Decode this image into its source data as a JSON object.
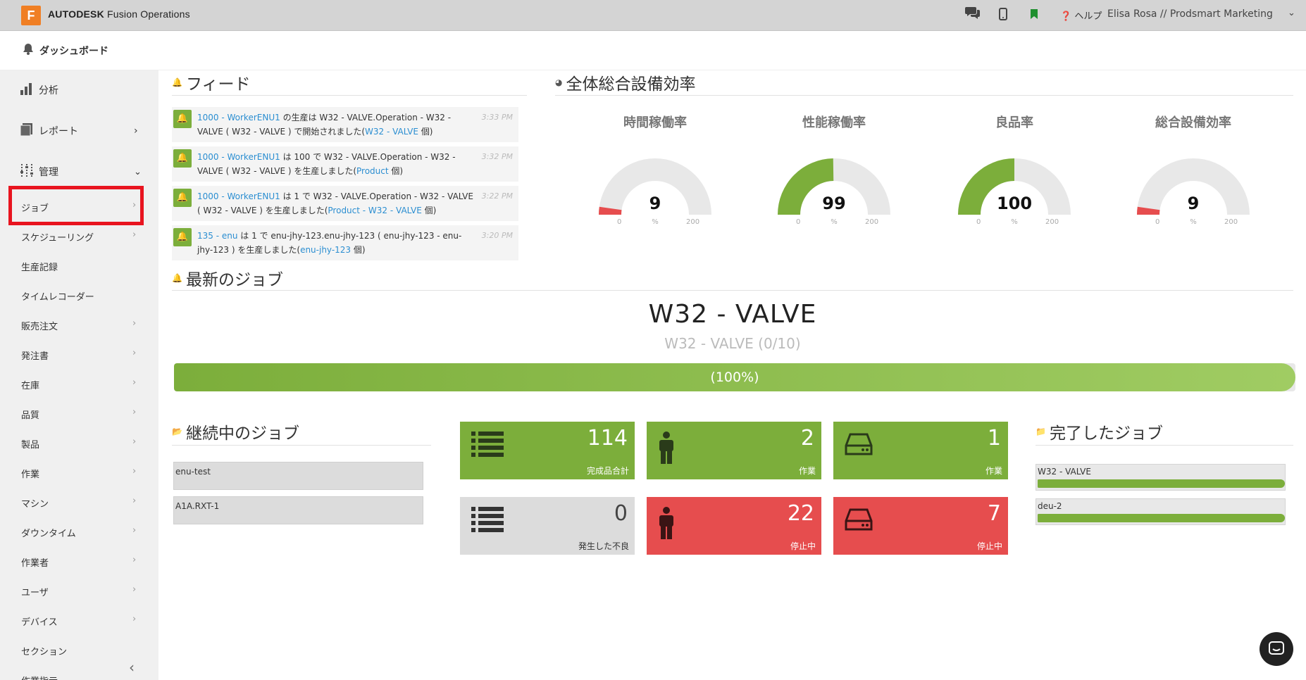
{
  "app": {
    "logo_letter": "F",
    "brand_bold": "AUTODESK",
    "brand_rest": " Fusion Operations",
    "accent": "#f07f24"
  },
  "topbar": {
    "help_label": "ヘルプ",
    "user_label": "Elisa Rosa // Prodsmart Marketing",
    "icons": [
      "chat-icon",
      "mobile-icon",
      "bookmark-icon",
      "help-icon"
    ]
  },
  "header": {
    "title": "ダッシュボード"
  },
  "sidebar": {
    "big_items": [
      {
        "label": "分析",
        "icon": "bar-chart-icon"
      },
      {
        "label": "レポート",
        "icon": "report-icon"
      },
      {
        "label": "管理",
        "icon": "sliders-icon"
      }
    ],
    "items": [
      {
        "label": "ジョブ"
      },
      {
        "label": "スケジューリング"
      },
      {
        "label": "生産記録"
      },
      {
        "label": "タイムレコーダー"
      },
      {
        "label": "販売注文"
      },
      {
        "label": "発注書"
      },
      {
        "label": "在庫"
      },
      {
        "label": "品質"
      },
      {
        "label": "製品"
      },
      {
        "label": "作業"
      },
      {
        "label": "マシン"
      },
      {
        "label": "ダウンタイム"
      },
      {
        "label": "作業者"
      },
      {
        "label": "ユーザ"
      },
      {
        "label": "デバイス"
      },
      {
        "label": "セクション"
      },
      {
        "label": "作業指示"
      }
    ]
  },
  "feed": {
    "title": "フィード",
    "items": [
      {
        "pre_link": "1000 - WorkerENU1",
        "text": " の生産は W32 - VALVE.Operation - W32 - VALVE ( W32 - VALVE ) で開始されました(",
        "link2": "W32 - VALVE",
        "post": " 個)",
        "time": "3:33 PM"
      },
      {
        "pre_link": "1000 - WorkerENU1",
        "text": " は 100 で W32 - VALVE.Operation - W32 - VALVE ( W32 - VALVE ) を生産しました(",
        "link2": "Product",
        "post": " 個)",
        "time": "3:32 PM"
      },
      {
        "pre_link": "1000 - WorkerENU1",
        "text": " は 1 で W32 - VALVE.Operation - W32 - VALVE ( W32 - VALVE ) を生産しました(",
        "link2": "Product - W32 - VALVE",
        "post": " 個)",
        "time": "3:22 PM"
      },
      {
        "pre_link": "135 - enu",
        "text": " は 1 で enu-jhy-123.enu-jhy-123 ( enu-jhy-123 - enu-jhy-123 ) を生産しました(",
        "link2": "enu-jhy-123",
        "post": " 個)",
        "time": "3:20 PM"
      }
    ]
  },
  "oee": {
    "title": "全体総合設備効率",
    "gauges": [
      {
        "label": "時間稼働率",
        "value": "9",
        "fraction": 0.045,
        "unit": "%",
        "min": "0",
        "max": "200",
        "color": "#e64d4e"
      },
      {
        "label": "性能稼働率",
        "value": "99",
        "fraction": 0.495,
        "unit": "%",
        "min": "0",
        "max": "200",
        "color": "#7cae3b"
      },
      {
        "label": "良品率",
        "value": "100",
        "fraction": 0.5,
        "unit": "%",
        "min": "0",
        "max": "200",
        "color": "#7cae3b"
      },
      {
        "label": "総合設備効率",
        "value": "9",
        "fraction": 0.045,
        "unit": "%",
        "min": "0",
        "max": "200",
        "color": "#e64d4e"
      }
    ]
  },
  "latest_job": {
    "title": "最新のジョブ",
    "name": "W32 - VALVE",
    "sub": "W32 - VALVE (0/10)",
    "progress_label": "(100%)",
    "progress": 1.0
  },
  "ongoing": {
    "title": "継続中のジョブ",
    "items": [
      "enu-test",
      "A1A.RXT-1"
    ]
  },
  "tiles": [
    {
      "value": "114",
      "label": "完成品合計",
      "icon": "list-icon",
      "color": "green"
    },
    {
      "value": "2",
      "label": "作業",
      "icon": "worker-icon",
      "color": "green"
    },
    {
      "value": "1",
      "label": "作業",
      "icon": "machine-icon",
      "color": "green"
    },
    {
      "value": "0",
      "label": "発生した不良",
      "icon": "list-icon",
      "color": "grey"
    },
    {
      "value": "22",
      "label": "停止中",
      "icon": "worker-icon",
      "color": "red"
    },
    {
      "value": "7",
      "label": "停止中",
      "icon": "machine-icon",
      "color": "red"
    }
  ],
  "completed": {
    "title": "完了したジョブ",
    "items": [
      "W32 - VALVE",
      "deu-2"
    ]
  }
}
